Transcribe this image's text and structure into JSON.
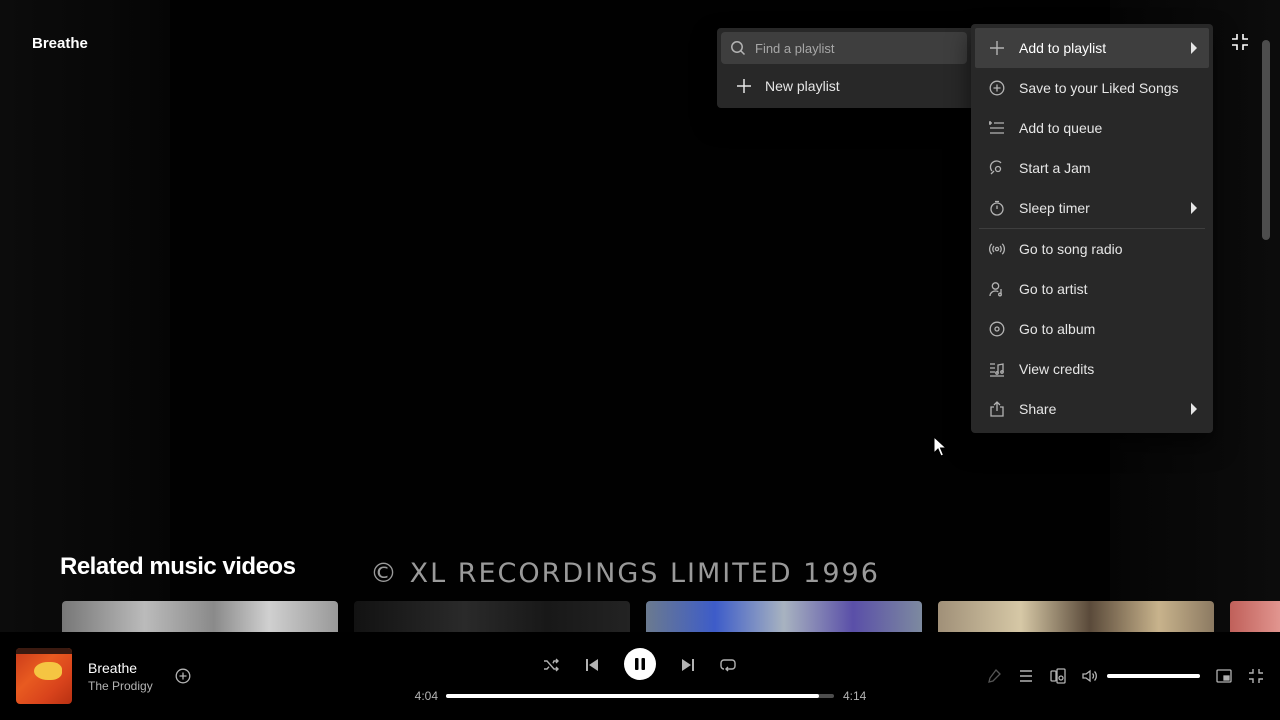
{
  "header": {
    "title": "Breathe"
  },
  "video": {
    "copyright_overlay": "© XL RECORDINGS LIMITED 1996"
  },
  "related": {
    "heading": "Related music videos"
  },
  "context_menu": {
    "items": [
      {
        "label": "Add to playlist",
        "icon": "plus-icon",
        "has_submenu": true
      },
      {
        "label": "Save to your Liked Songs",
        "icon": "add-circle-icon",
        "has_submenu": false
      },
      {
        "label": "Add to queue",
        "icon": "queue-icon",
        "has_submenu": false
      },
      {
        "label": "Start a Jam",
        "icon": "jam-icon",
        "has_submenu": false
      },
      {
        "label": "Sleep timer",
        "icon": "timer-icon",
        "has_submenu": true
      },
      {
        "label": "Go to song radio",
        "icon": "radio-icon",
        "has_submenu": false
      },
      {
        "label": "Go to artist",
        "icon": "artist-icon",
        "has_submenu": false
      },
      {
        "label": "Go to album",
        "icon": "album-icon",
        "has_submenu": false
      },
      {
        "label": "View credits",
        "icon": "credits-icon",
        "has_submenu": false
      },
      {
        "label": "Share",
        "icon": "share-icon",
        "has_submenu": true
      }
    ]
  },
  "playlist_submenu": {
    "search_placeholder": "Find a playlist",
    "new_playlist_label": "New playlist"
  },
  "now_playing": {
    "title": "Breathe",
    "artist": "The Prodigy",
    "elapsed": "4:04",
    "duration": "4:14",
    "progress_fraction": 0.961,
    "volume_fraction": 1.0,
    "is_playing": true
  },
  "colors": {
    "menu_bg": "#282828",
    "menu_hover": "#3e3e3e",
    "accent_white": "#ffffff",
    "muted_text": "#b3b3b3"
  }
}
